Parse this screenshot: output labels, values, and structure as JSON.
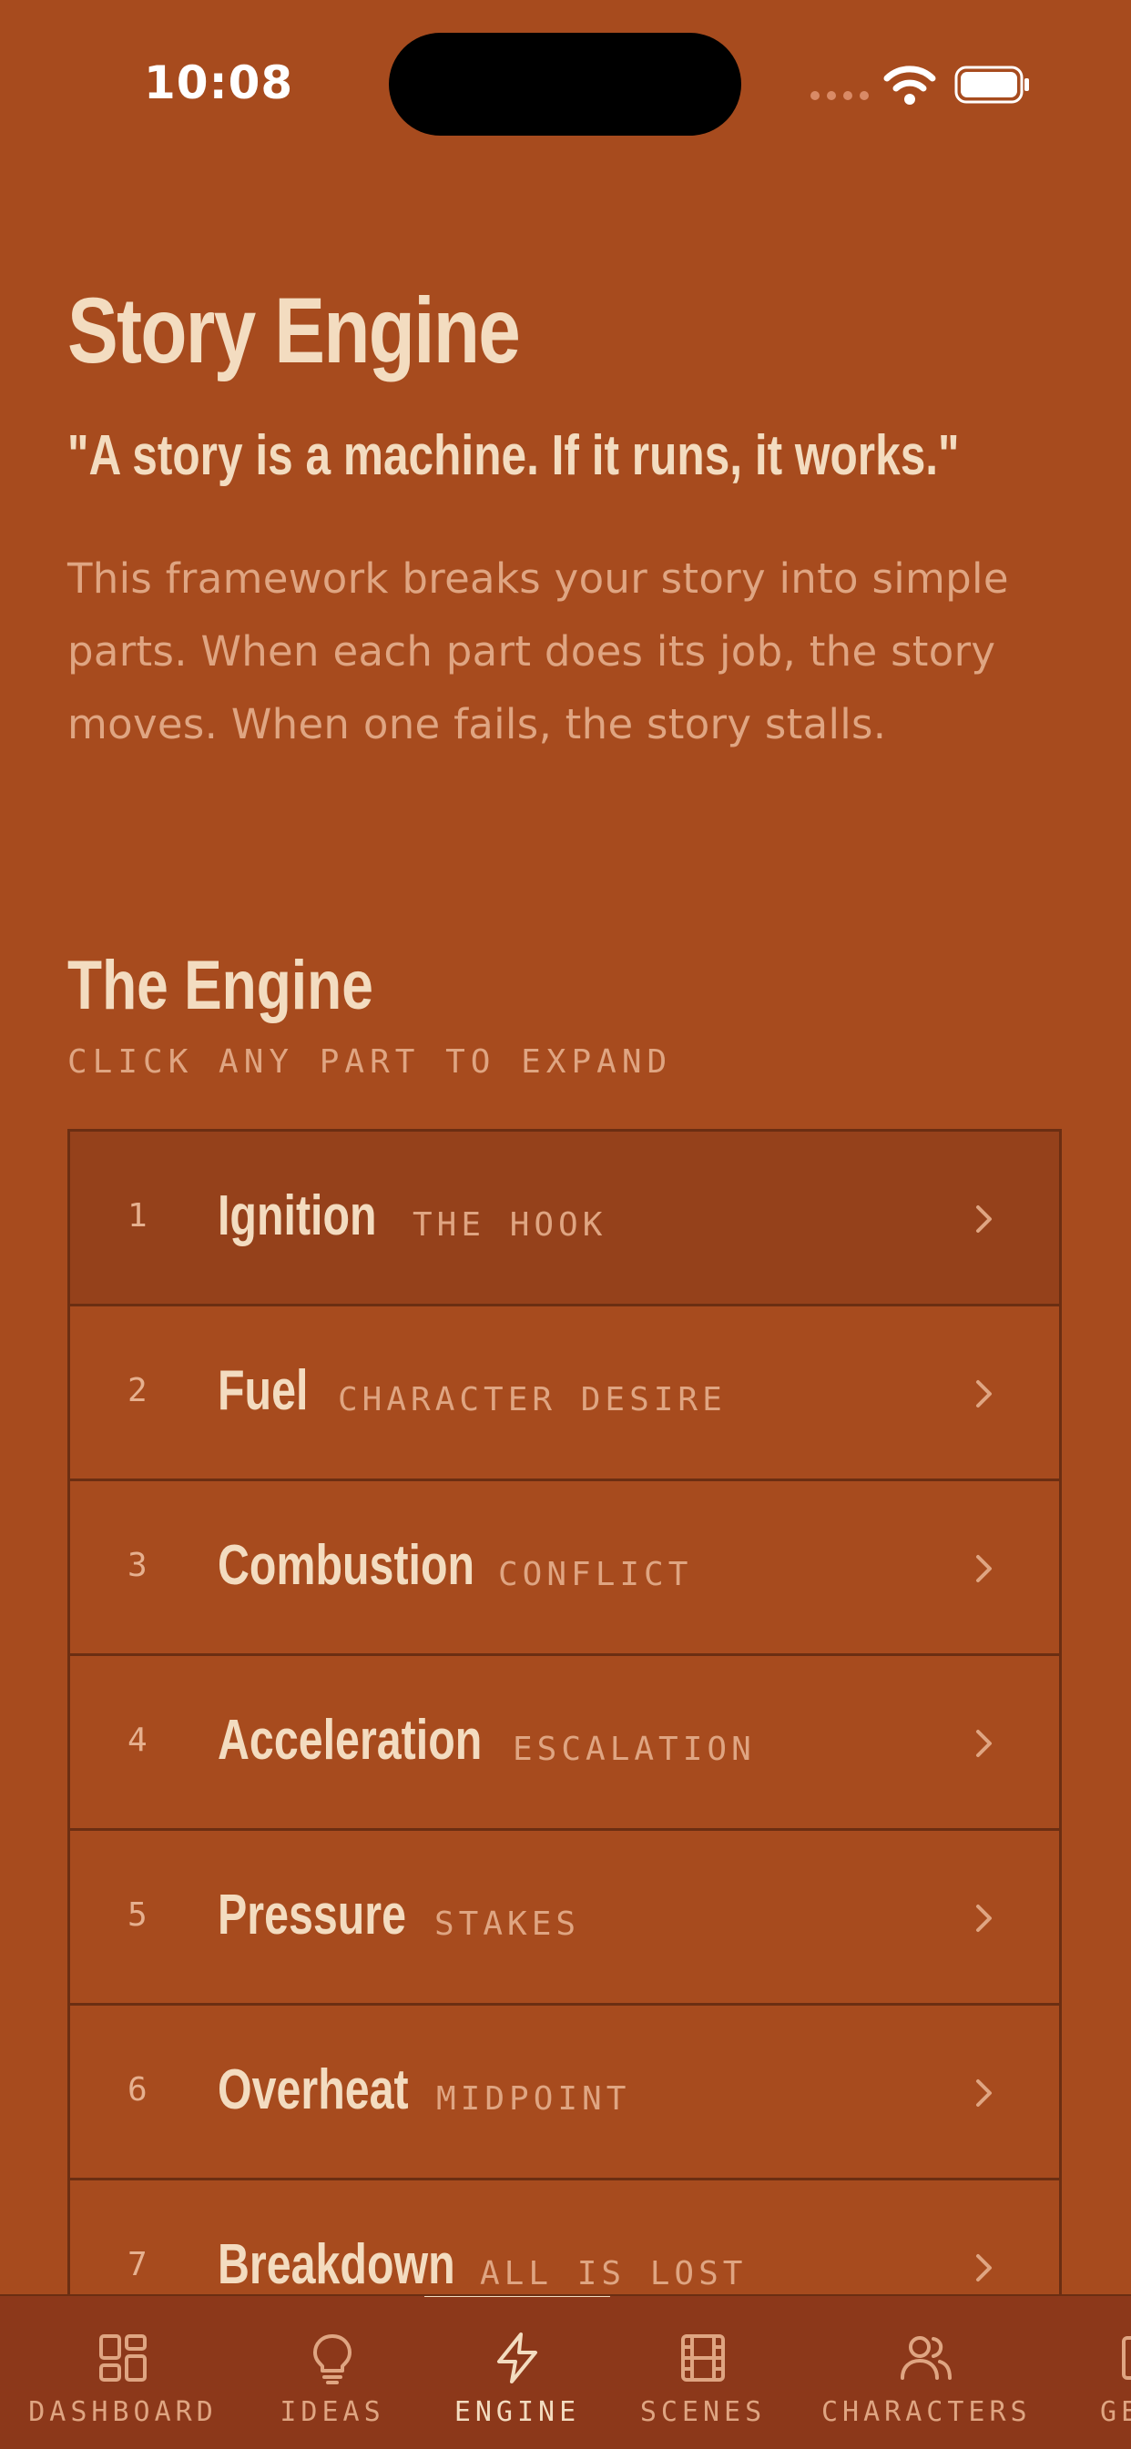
{
  "status_bar": {
    "time": "10:08"
  },
  "header": {
    "title": "Story Engine",
    "quote": "\"A story is a machine. If it runs, it works.\"",
    "description": "This framework breaks your story into simple parts. When each part does its job, the story moves. When one fails, the story stalls."
  },
  "engine": {
    "title": "The Engine",
    "subtitle": "CLICK ANY PART TO EXPAND",
    "parts": [
      {
        "number": "1",
        "title": "Ignition",
        "subtitle": "THE HOOK"
      },
      {
        "number": "2",
        "title": "Fuel",
        "subtitle": "CHARACTER DESIRE"
      },
      {
        "number": "3",
        "title": "Combustion",
        "subtitle": "CONFLICT"
      },
      {
        "number": "4",
        "title": "Acceleration",
        "subtitle": "ESCALATION"
      },
      {
        "number": "5",
        "title": "Pressure",
        "subtitle": "STAKES"
      },
      {
        "number": "6",
        "title": "Overheat",
        "subtitle": "MIDPOINT"
      },
      {
        "number": "7",
        "title": "Breakdown",
        "subtitle": "ALL IS LOST"
      }
    ]
  },
  "tab_bar": {
    "active": "ENGINE",
    "tabs": [
      {
        "label": "DASHBOARD",
        "icon": "dashboard-icon"
      },
      {
        "label": "IDEAS",
        "icon": "lightbulb-icon"
      },
      {
        "label": "ENGINE",
        "icon": "lightning-icon"
      },
      {
        "label": "SCENES",
        "icon": "film-icon"
      },
      {
        "label": "CHARACTERS",
        "icon": "users-icon"
      },
      {
        "label": "GE",
        "icon": "partial-icon"
      }
    ]
  },
  "colors": {
    "background": "#a74b1e",
    "accent_text": "#f3dcc0",
    "muted_text": "#dfa582",
    "border": "#6b2e12",
    "tab_bar": "#8c381a"
  }
}
